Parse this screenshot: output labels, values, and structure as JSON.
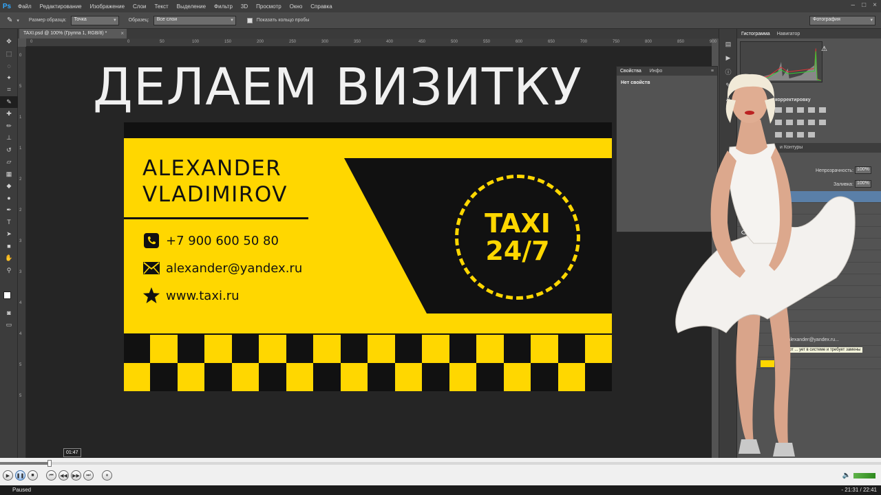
{
  "app": {
    "logo": "Ps",
    "menu": [
      "Файл",
      "Редактирование",
      "Изображение",
      "Слои",
      "Текст",
      "Выделение",
      "Фильтр",
      "3D",
      "Просмотр",
      "Окно",
      "Справка"
    ],
    "window_controls": [
      "–",
      "□",
      "×"
    ]
  },
  "options_bar": {
    "sample_size_label": "Размер образца:",
    "sample_size_value": "Точка",
    "sample_label": "Образец:",
    "sample_value": "Все слои",
    "show_ring_label": "Показать кольцо пробы",
    "workspace": "Фотография"
  },
  "document": {
    "tab_title": "TAXI.psd @ 100% (Группа 1, RGB/8) *",
    "close": "×",
    "ruler_h_labels": [
      "0",
      "0",
      "50",
      "100",
      "150",
      "200",
      "250",
      "300",
      "350",
      "400",
      "450",
      "500",
      "550",
      "600",
      "650",
      "700",
      "750",
      "800",
      "850",
      "900",
      "950"
    ],
    "ruler_v_labels": [
      "0",
      "5",
      "1",
      "1",
      "2",
      "2",
      "3",
      "3",
      "4",
      "4",
      "5",
      "5"
    ]
  },
  "canvas": {
    "headline": "ДЕЛАЕМ ВИЗИТКУ",
    "card": {
      "name": "ALEXANDER\nVLADIMIROV",
      "phone": "+7 900 600 50 80",
      "email": "alexander@yandex.ru",
      "website": "www.taxi.ru",
      "badge_line1": "TAXI",
      "badge_line2": "24/7"
    },
    "colors": {
      "yellow": "#ffd700",
      "black": "#111111",
      "canvas_bg": "#252525"
    }
  },
  "properties_panel": {
    "tabs": [
      "Свойства",
      "Инфо"
    ],
    "empty_text": "Нет свойств"
  },
  "right_panels": {
    "top_tabs": [
      "Гистограмма",
      "Навигатор"
    ],
    "adjust_title": "корректировку",
    "layers_tabs": "и    Контуры",
    "opacity_label": "Непрозрачность:",
    "opacity_value": "100%",
    "fill_label": "Заливка:",
    "fill_value": "100%",
    "layers": [
      {
        "name": "уппа 1"
      },
      {
        "name": ""
      },
      {
        "name": ""
      },
      {
        "name": ""
      },
      {
        "name": ""
      },
      {
        "name": ""
      },
      {
        "name": ""
      },
      {
        "name": ""
      },
      {
        "name": ""
      },
      {
        "name": "ра 3"
      },
      {
        "name": ""
      },
      {
        "name": "ник 3"
      },
      {
        "name": "0 80 alexander@yandex.ru..."
      },
      {
        "name": ""
      },
      {
        "name": "Фо"
      }
    ],
    "tooltip": "Шрифт ... ует в системе и требует замены"
  },
  "player": {
    "progress": 0.056,
    "timestamp_bubble": "01:47",
    "status": "Paused",
    "time": "- 21:31 / 22:41"
  }
}
